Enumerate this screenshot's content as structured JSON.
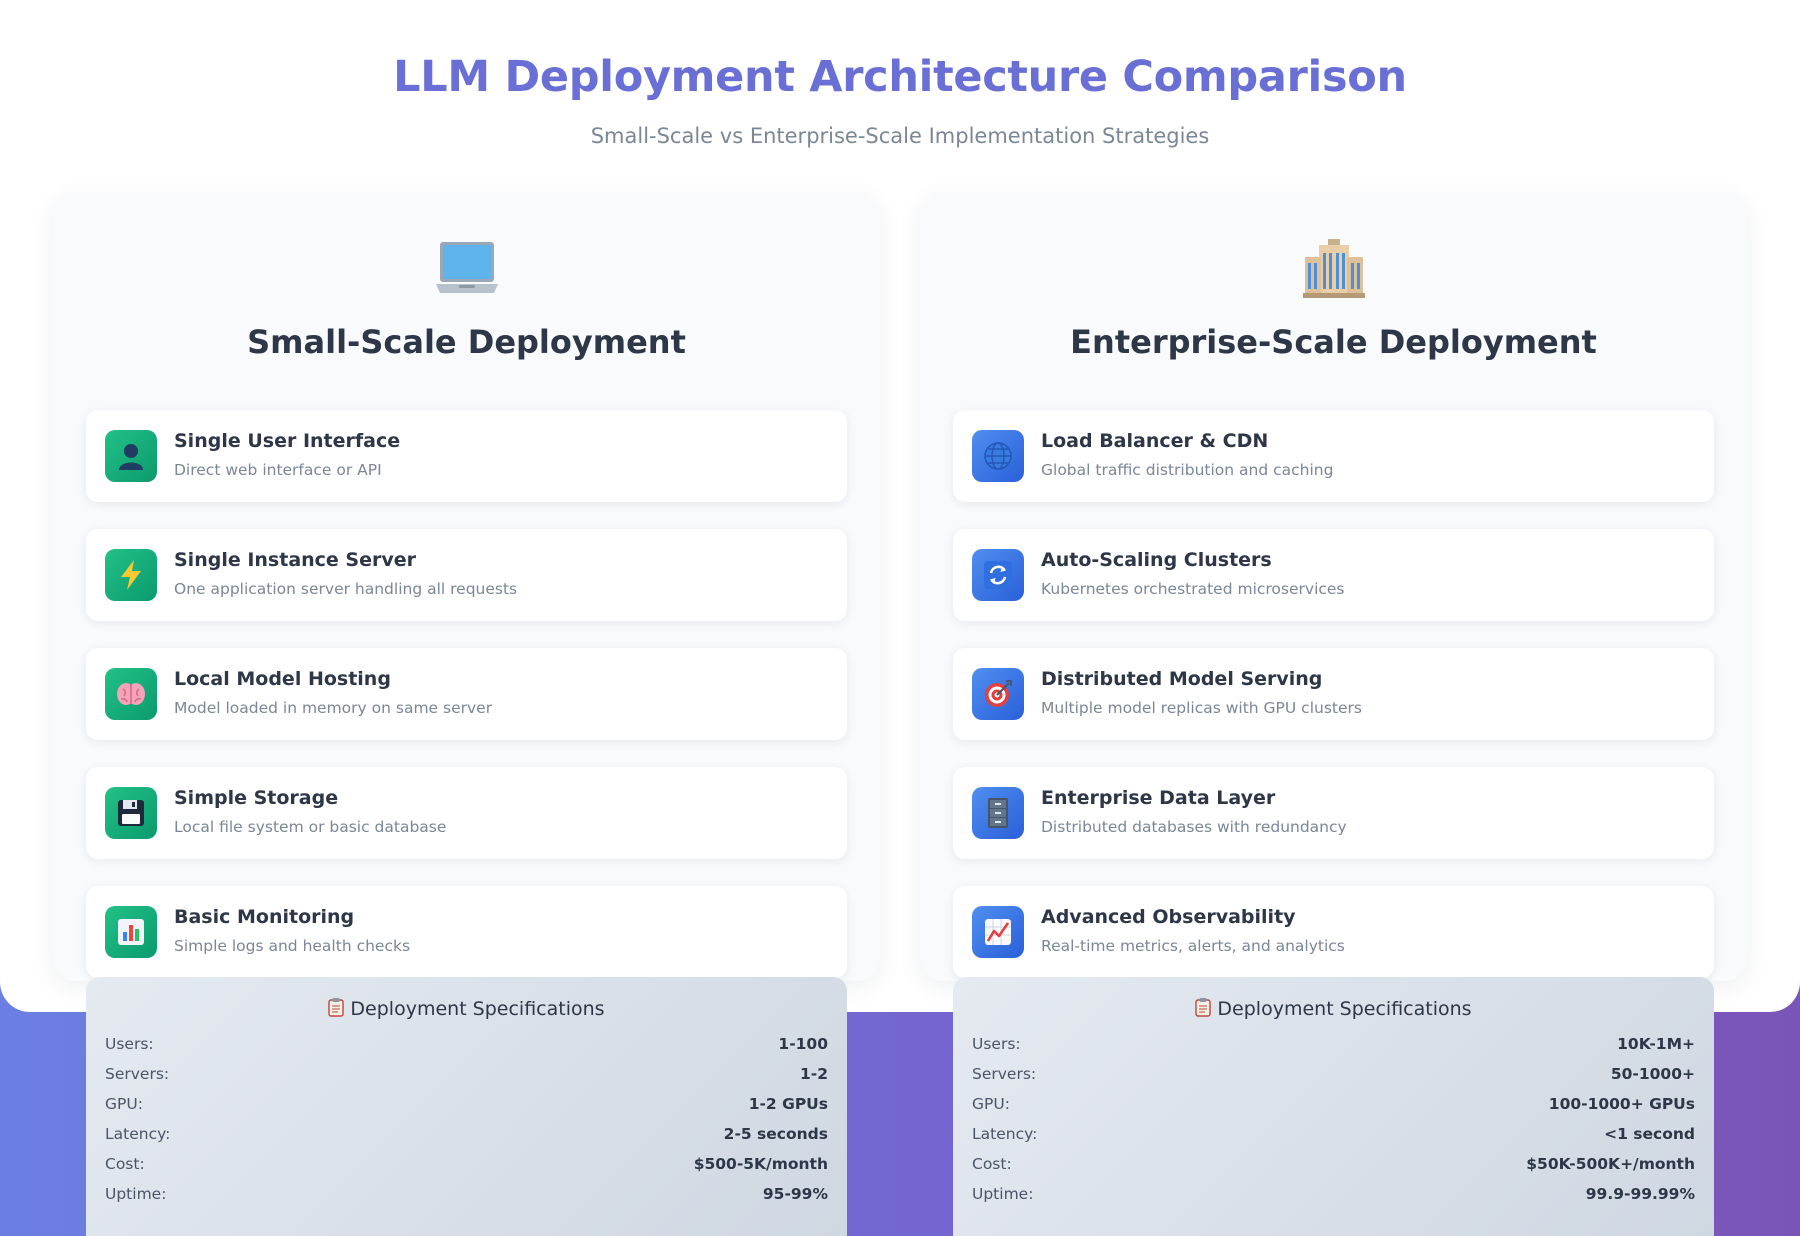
{
  "header": {
    "title": "LLM Deployment Architecture Comparison",
    "subtitle": "Small-Scale vs Enterprise-Scale Implementation Strategies"
  },
  "small": {
    "icon": "laptop-icon",
    "title": "Small-Scale Deployment",
    "accent": "#10b981",
    "items": [
      {
        "icon": "user-silhouette-icon",
        "title": "Single User Interface",
        "desc": "Direct web interface or API"
      },
      {
        "icon": "lightning-icon",
        "title": "Single Instance Server",
        "desc": "One application server handling all requests"
      },
      {
        "icon": "brain-icon",
        "title": "Local Model Hosting",
        "desc": "Model loaded in memory on same server"
      },
      {
        "icon": "floppy-disk-icon",
        "title": "Simple Storage",
        "desc": "Local file system or basic database"
      },
      {
        "icon": "bar-chart-icon",
        "title": "Basic Monitoring",
        "desc": "Simple logs and health checks"
      }
    ],
    "specs_title": "Deployment Specifications",
    "specs": [
      {
        "label": "Users:",
        "value": "1-100"
      },
      {
        "label": "Servers:",
        "value": "1-2"
      },
      {
        "label": "GPU:",
        "value": "1-2 GPUs"
      },
      {
        "label": "Latency:",
        "value": "2-5 seconds"
      },
      {
        "label": "Cost:",
        "value": "$500-5K/month"
      },
      {
        "label": "Uptime:",
        "value": "95-99%"
      }
    ]
  },
  "enterprise": {
    "icon": "office-building-icon",
    "title": "Enterprise-Scale Deployment",
    "accent": "#3b82f6",
    "items": [
      {
        "icon": "globe-icon",
        "title": "Load Balancer & CDN",
        "desc": "Global traffic distribution and caching"
      },
      {
        "icon": "refresh-arrows-icon",
        "title": "Auto-Scaling Clusters",
        "desc": "Kubernetes orchestrated microservices"
      },
      {
        "icon": "target-icon",
        "title": "Distributed Model Serving",
        "desc": "Multiple model replicas with GPU clusters"
      },
      {
        "icon": "file-cabinet-icon",
        "title": "Enterprise Data Layer",
        "desc": "Distributed databases with redundancy"
      },
      {
        "icon": "trending-chart-icon",
        "title": "Advanced Observability",
        "desc": "Real-time metrics, alerts, and analytics"
      }
    ],
    "specs_title": "Deployment Specifications",
    "specs": [
      {
        "label": "Users:",
        "value": "10K-1M+"
      },
      {
        "label": "Servers:",
        "value": "50-1000+"
      },
      {
        "label": "GPU:",
        "value": "100-1000+ GPUs"
      },
      {
        "label": "Latency:",
        "value": "<1 second"
      },
      {
        "label": "Cost:",
        "value": "$50K-500K+/month"
      },
      {
        "label": "Uptime:",
        "value": "99.9-99.99%"
      }
    ]
  }
}
